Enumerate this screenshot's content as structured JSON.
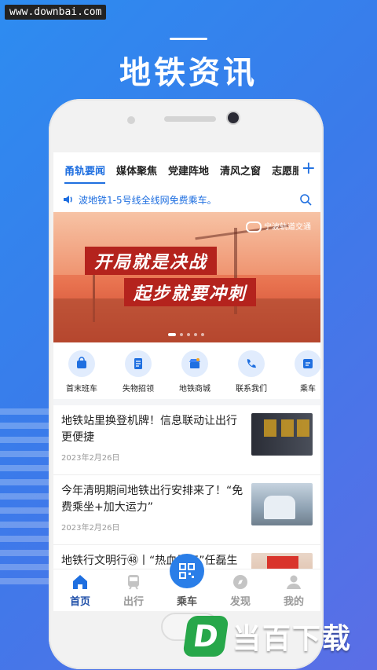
{
  "watermark": "www.downbai.com",
  "hero": {
    "title": "地铁资讯"
  },
  "tabs": [
    {
      "label": "甬轨要闻",
      "active": true
    },
    {
      "label": "媒体聚焦",
      "active": false
    },
    {
      "label": "党建阵地",
      "active": false
    },
    {
      "label": "清风之窗",
      "active": false
    },
    {
      "label": "志愿服",
      "active": false
    }
  ],
  "tab_add": "+",
  "notice": {
    "text": "波地铁1-5号线全线网免费乘车。"
  },
  "banner": {
    "logo_text": "宁波轨道交通",
    "slogan_line1": "开局就是决战",
    "slogan_line2": "起步就要冲刺",
    "slide_count": 5,
    "active_slide": 0
  },
  "quick_links": [
    {
      "label": "首末班车",
      "icon": "bag-icon"
    },
    {
      "label": "失物招领",
      "icon": "document-icon"
    },
    {
      "label": "地铁商城",
      "icon": "shop-icon"
    },
    {
      "label": "联系我们",
      "icon": "phone-icon"
    },
    {
      "label": "乘车",
      "icon": "ticket-icon"
    }
  ],
  "news": [
    {
      "title": "地铁站里换登机牌！信息联动让出行更便捷",
      "date": "2023年2月26日"
    },
    {
      "title": "今年清明期间地铁出行安排来了！“免费乘坐+加大运力”",
      "date": "2023年2月26日"
    },
    {
      "title": "地铁行文明行㊽丨“热血青年”任磊生荣获“宁波好人”称号",
      "date": ""
    }
  ],
  "bottom_nav": [
    {
      "label": "首页",
      "icon": "home-icon",
      "active": true
    },
    {
      "label": "出行",
      "icon": "train-icon",
      "active": false
    },
    {
      "label": "乘车",
      "icon": "qr-code-icon",
      "active": false
    },
    {
      "label": "发现",
      "icon": "compass-icon",
      "active": false
    },
    {
      "label": "我的",
      "icon": "user-icon",
      "active": false
    }
  ],
  "brand": {
    "mark": "D",
    "text": "当百下载"
  },
  "colors": {
    "accent": "#1f6fe0",
    "background": "#2d8cf0",
    "brand_green": "#27a74a"
  }
}
